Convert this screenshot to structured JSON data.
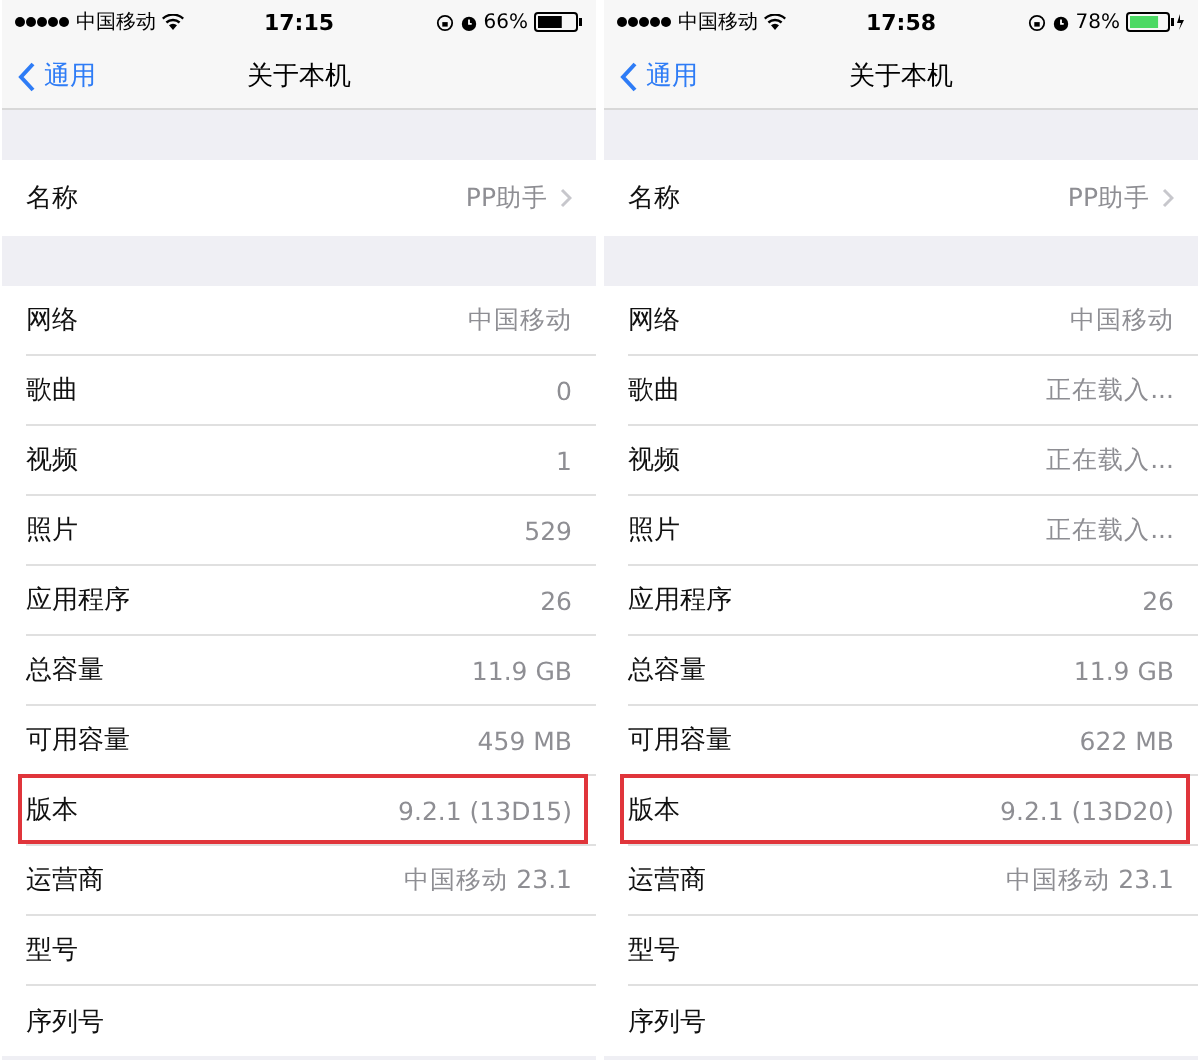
{
  "phones": [
    {
      "status_bar": {
        "carrier": "中国移动",
        "time": "17:15",
        "battery_percent": "66%",
        "battery": {
          "level": 0.66,
          "charging": false
        }
      },
      "nav": {
        "back": "通用",
        "title": "关于本机"
      },
      "name_row": {
        "label": "名称",
        "value": "PP助手"
      },
      "rows": [
        {
          "label": "网络",
          "value": "中国移动",
          "highlighted": false
        },
        {
          "label": "歌曲",
          "value": "0",
          "highlighted": false
        },
        {
          "label": "视频",
          "value": "1",
          "highlighted": false
        },
        {
          "label": "照片",
          "value": "529",
          "highlighted": false
        },
        {
          "label": "应用程序",
          "value": "26",
          "highlighted": false
        },
        {
          "label": "总容量",
          "value": "11.9 GB",
          "highlighted": false
        },
        {
          "label": "可用容量",
          "value": "459 MB",
          "highlighted": false
        },
        {
          "label": "版本",
          "value": "9.2.1 (13D15)",
          "highlighted": true
        },
        {
          "label": "运营商",
          "value": "中国移动 23.1",
          "highlighted": false
        },
        {
          "label": "型号",
          "highlighted": false
        },
        {
          "label": "序列号",
          "highlighted": false
        }
      ]
    },
    {
      "status_bar": {
        "carrier": "中国移动",
        "time": "17:58",
        "battery_percent": "78%",
        "battery": {
          "level": 0.78,
          "charging": true
        }
      },
      "nav": {
        "back": "通用",
        "title": "关于本机"
      },
      "name_row": {
        "label": "名称",
        "value": "PP助手"
      },
      "rows": [
        {
          "label": "网络",
          "value": "中国移动",
          "highlighted": false
        },
        {
          "label": "歌曲",
          "value": "正在载入...",
          "highlighted": false
        },
        {
          "label": "视频",
          "value": "正在载入...",
          "highlighted": false
        },
        {
          "label": "照片",
          "value": "正在载入...",
          "highlighted": false
        },
        {
          "label": "应用程序",
          "value": "26",
          "highlighted": false
        },
        {
          "label": "总容量",
          "value": "11.9 GB",
          "highlighted": false
        },
        {
          "label": "可用容量",
          "value": "622 MB",
          "highlighted": false
        },
        {
          "label": "版本",
          "value": "9.2.1 (13D20)",
          "highlighted": true
        },
        {
          "label": "运营商",
          "value": "中国移动 23.1",
          "highlighted": false
        },
        {
          "label": "型号",
          "highlighted": false
        },
        {
          "label": "序列号",
          "highlighted": false
        }
      ]
    }
  ]
}
